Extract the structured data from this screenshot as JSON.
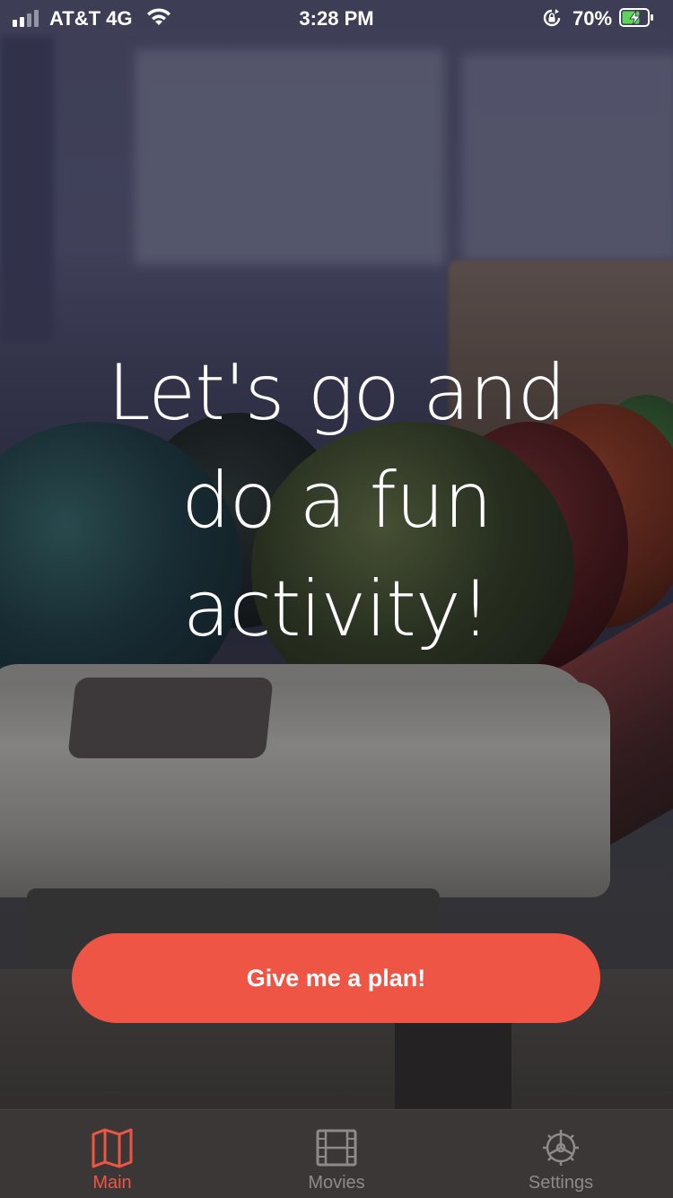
{
  "status_bar": {
    "carrier": "AT&T 4G",
    "time": "3:28 PM",
    "battery_percent": "70%",
    "signal_bars": 2,
    "signal_bars_total": 4,
    "battery_level": 0.7,
    "charging": true
  },
  "main": {
    "headline_lines": [
      "Let's go and",
      "do a fun",
      "activity!"
    ],
    "cta_label": "Give me a plan!"
  },
  "tab_bar": {
    "tabs": [
      {
        "label": "Main",
        "icon": "map-icon",
        "active": true
      },
      {
        "label": "Movies",
        "icon": "film-icon",
        "active": false
      },
      {
        "label": "Settings",
        "icon": "gear-icon",
        "active": false
      }
    ]
  },
  "colors": {
    "accent": "#ef5545",
    "tab_bar_bg": "#3a3736",
    "tab_inactive": "#8d8a88",
    "text": "#ffffff"
  }
}
